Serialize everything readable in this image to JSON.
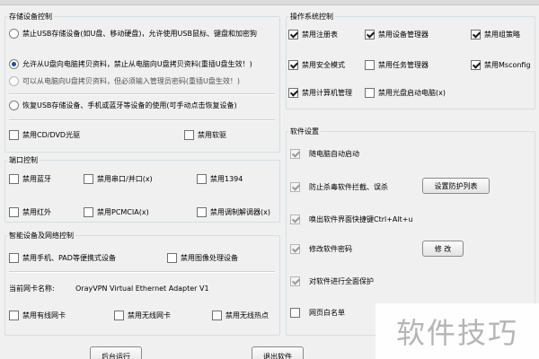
{
  "storage": {
    "title": "存储设备控制",
    "options": [
      "禁止USB存储设备(如U盘、移动硬盘)，允许使用USB鼠标、键盘和加密狗",
      "允许从U盘向电脑拷贝资料，禁止从电脑向U盘拷贝资料(重插U盘生效！)",
      "可以从电脑向U盘拷贝资料，但必须输入管理员密码(重插U盘生效！)",
      "恢复USB存储设备、手机或蓝牙等设备的使用(可手动点击恢复设备)"
    ],
    "selected_index": 1,
    "disable_cd": "禁用CD/DVD光驱",
    "disable_floppy": "禁用软驱"
  },
  "ports": {
    "title": "端口控制",
    "bluetooth": "禁用蓝牙",
    "serial": "禁用串口/并口(x)",
    "ieee1394": "禁用1394",
    "infrared": "禁用红外",
    "pcmcia": "禁用PCMCIA(x)",
    "modem": "禁用调制解调器(x)"
  },
  "smart": {
    "title": "智能设备及网络控制",
    "phone": "禁用手机、PAD等便携式设备",
    "imaging": "禁用图像处理设备",
    "nic_label": "当前网卡名称:",
    "nic_value": "OrayVPN Virtual Ethernet Adapter V1",
    "wired": "禁用有线网卡",
    "wireless": "禁用无线网卡",
    "hotspot": "禁用无线热点"
  },
  "os": {
    "title": "操作系统控制",
    "registry": "禁用注册表",
    "device_manager": "禁用设备管理器",
    "group_policy": "禁用组策略",
    "safe_mode": "禁用安全模式",
    "task_manager": "禁用任务管理器",
    "msconfig": "禁用Msconfig",
    "computer_mgmt": "禁用计算机管理",
    "cd_autorun": "禁用光盘启动电脑(x)"
  },
  "software": {
    "title": "软件设置",
    "autostart": "随电脑自动启动",
    "anti_kill": "防止杀毒软件拦截、误杀",
    "protect_list_btn": "设置防护列表",
    "hotkey": "唤出软件界面快捷键Ctrl+Alt+u",
    "change_pwd": "修改软件密码",
    "change_btn": "修 改",
    "full_protect": "对软件进行全面保护",
    "whitelist": "网页白名单"
  },
  "footer": {
    "run_bg": "后台运行",
    "exit": "退出软件"
  },
  "watermark": "软件技巧"
}
